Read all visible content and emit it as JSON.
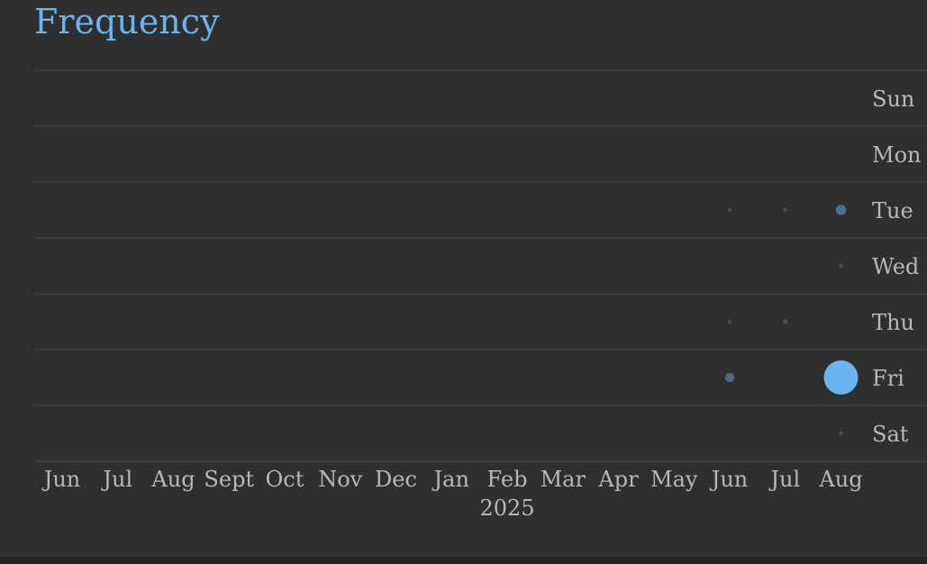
{
  "title": "Frequency",
  "colors": {
    "background": "#2f2f2f",
    "accent": "#6ab4f2",
    "grid": "#404040",
    "label": "#b8b8b8"
  },
  "chart_data": {
    "type": "scatter",
    "title": "Frequency",
    "x_tick_labels": [
      "Jun",
      "Jul",
      "Aug",
      "Sept",
      "Oct",
      "Nov",
      "Dec",
      "Jan",
      "Feb",
      "Mar",
      "Apr",
      "May",
      "Jun",
      "Jul",
      "Aug"
    ],
    "x_year_label": {
      "text": "2025",
      "under_tick": "Feb"
    },
    "y_labels": [
      "Sun",
      "Mon",
      "Tue",
      "Wed",
      "Thu",
      "Fri",
      "Sat"
    ],
    "y_label_position": "right",
    "grid": true,
    "points": [
      {
        "x": "Jun",
        "x_index": 12,
        "y": "Tue",
        "value": 0.05
      },
      {
        "x": "Jul",
        "x_index": 13,
        "y": "Tue",
        "value": 0.05
      },
      {
        "x": "Aug",
        "x_index": 14,
        "y": "Tue",
        "value": 0.3
      },
      {
        "x": "Aug",
        "x_index": 14,
        "y": "Wed",
        "value": 0.05
      },
      {
        "x": "Jun",
        "x_index": 12,
        "y": "Thu",
        "value": 0.05
      },
      {
        "x": "Jul",
        "x_index": 13,
        "y": "Thu",
        "value": 0.07
      },
      {
        "x": "Jun",
        "x_index": 12,
        "y": "Fri",
        "value": 0.25
      },
      {
        "x": "Aug",
        "x_index": 14,
        "y": "Fri",
        "value": 1.0
      },
      {
        "x": "Aug",
        "x_index": 14,
        "y": "Sat",
        "value": 0.05
      }
    ]
  }
}
